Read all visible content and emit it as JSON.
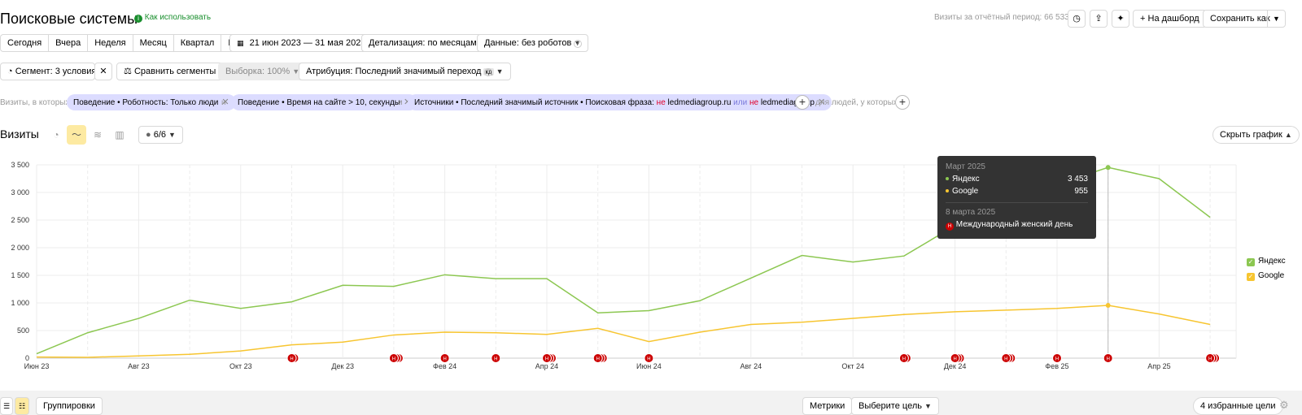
{
  "header": {
    "title": "Поисковые системы",
    "help_link": "Как использовать",
    "visits_summary": "Визиты за отчётный период: 66 533",
    "to_dashboard": "На дашборд",
    "save_as": "Сохранить как"
  },
  "periods": [
    "Сегодня",
    "Вчера",
    "Неделя",
    "Месяц",
    "Квартал",
    "Год"
  ],
  "date_range": "21 июн 2023 — 31 мая 2025",
  "detail": "Детализация: по месяцам",
  "data_filter": "Данные: без роботов",
  "segment": "Сегмент: 3 условия",
  "compare": "Сравнить сегменты",
  "sample": "Выборка: 100%",
  "attribution": "Атрибуция: Последний значимый переход",
  "attribution_badge": "кд",
  "filters": {
    "prefix": "Визиты, в которых",
    "and": "и",
    "chip1": "Поведение • Роботность: Только люди",
    "chip2": "Поведение • Время на сайте > 10, секунды",
    "chip3_text": "Источники • Последний значимый источник • Поисковая фраза:",
    "chip3_ne1": "не",
    "chip3_val1": "ledmediagroup.ru",
    "chip3_or": "или",
    "chip3_ne2": "не",
    "chip3_val2": "ledmediagroup",
    "suffix": "для людей, у которых"
  },
  "chart_toolbar": {
    "title": "Визиты",
    "annotations_count": "6/6",
    "hide_chart": "Скрыть график"
  },
  "tooltip": {
    "period": "Март 2025",
    "yandex_label": "Яндекс",
    "yandex_value": "3 453",
    "google_label": "Google",
    "google_value": "955",
    "event_date": "8 марта 2025",
    "event_name": "Международный женский день"
  },
  "bottom": {
    "groupings": "Группировки",
    "metrics": "Метрики",
    "choose_goal": "Выберите цель",
    "favorite_goals": "4 избранные цели"
  },
  "colors": {
    "yandex": "#8cc751",
    "google": "#f7c530",
    "annotation": "#cc0000",
    "chip_bg": "#dcdcff",
    "tooltip_bg": "#333333"
  },
  "chart_data": {
    "type": "line",
    "ylim": [
      0,
      3500
    ],
    "y_ticks": [
      "0",
      "500",
      "1 000",
      "1 500",
      "2 000",
      "2 500",
      "3 000",
      "3 500"
    ],
    "x": [
      "Июн 23",
      "Июл 23",
      "Авг 23",
      "Сен 23",
      "Окт 23",
      "Ноя 23",
      "Дек 23",
      "Янв 24",
      "Фев 24",
      "Мар 24",
      "Апр 24",
      "Май 24",
      "Июн 24",
      "Июл 24",
      "Авг 24",
      "Сен 24",
      "Окт 24",
      "Ноя 24",
      "Дек 24",
      "Янв 25",
      "Фев 25",
      "Мар 25",
      "Апр 25",
      "Май 25"
    ],
    "x_tick_labels": [
      "Июн 23",
      "Авг 23",
      "Окт 23",
      "Дек 23",
      "Фев 24",
      "Апр 24",
      "Июн 24",
      "Авг 24",
      "Окт 24",
      "Дек 24",
      "Фев 25",
      "Апр 25"
    ],
    "series": [
      {
        "name": "Яндекс",
        "color": "#8cc751",
        "values": [
          80,
          460,
          720,
          1050,
          900,
          1020,
          1320,
          1300,
          1510,
          1440,
          1440,
          820,
          860,
          1040,
          1450,
          1860,
          1740,
          1850,
          2400,
          2900,
          3150,
          3453,
          3250,
          2550
        ]
      },
      {
        "name": "Google",
        "color": "#f7c530",
        "values": [
          20,
          15,
          40,
          70,
          130,
          240,
          290,
          420,
          470,
          460,
          430,
          540,
          300,
          470,
          610,
          650,
          720,
          790,
          840,
          870,
          900,
          955,
          800,
          610
        ]
      }
    ],
    "annotation_markers": [
      {
        "x": 5,
        "n": 2
      },
      {
        "x": 7,
        "n": 3
      },
      {
        "x": 8,
        "n": 1
      },
      {
        "x": 9,
        "n": 1
      },
      {
        "x": 10,
        "n": 3
      },
      {
        "x": 11,
        "n": 3
      },
      {
        "x": 12,
        "n": 1
      },
      {
        "x": 17,
        "n": 2
      },
      {
        "x": 18,
        "n": 3
      },
      {
        "x": 19,
        "n": 3
      },
      {
        "x": 20,
        "n": 1
      },
      {
        "x": 21,
        "n": 1
      },
      {
        "x": 23,
        "n": 3
      }
    ],
    "highlight_index": 21,
    "legend_position": "right",
    "grid": true
  }
}
